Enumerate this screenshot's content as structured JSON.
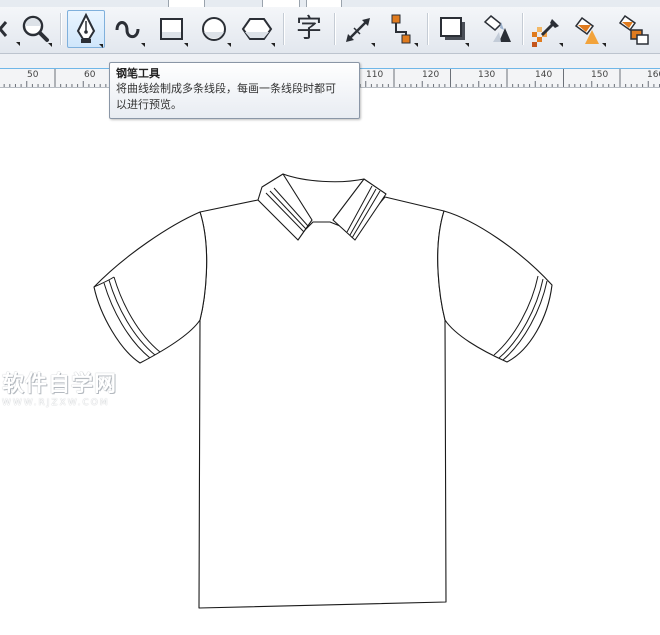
{
  "toolbar": {
    "tools": [
      {
        "id": "partial-left",
        "icon": "tool-icon"
      },
      {
        "id": "zoom",
        "icon": "magnifier-icon"
      },
      {
        "id": "pen",
        "icon": "pen-nib-icon",
        "active": true
      },
      {
        "id": "smart-drawing",
        "icon": "freehand-curve-icon"
      },
      {
        "id": "rectangle",
        "icon": "rectangle-icon"
      },
      {
        "id": "ellipse",
        "icon": "ellipse-icon"
      },
      {
        "id": "polygon",
        "icon": "polygon-icon"
      },
      {
        "id": "text",
        "icon": "text-icon",
        "glyph": "字"
      },
      {
        "id": "dimension",
        "icon": "dimension-arrow-icon"
      },
      {
        "id": "connector",
        "icon": "connector-icon"
      },
      {
        "id": "drop-shadow",
        "icon": "drop-shadow-icon"
      },
      {
        "id": "transparency",
        "icon": "transparency-icon"
      },
      {
        "id": "eyedropper",
        "icon": "eyedropper-icon"
      },
      {
        "id": "interactive-fill",
        "icon": "fill-bucket-icon"
      },
      {
        "id": "smart-fill",
        "icon": "smart-fill-icon"
      }
    ]
  },
  "ruler": {
    "labels": [
      "50",
      "60",
      "110",
      "120",
      "130",
      "140",
      "150",
      "160"
    ]
  },
  "tooltip": {
    "title": "钢笔工具",
    "body_line1": "将曲线绘制成多条线段，每画一条线段时都可",
    "body_line2": "以进行预览。"
  },
  "watermark": {
    "text": "软件自学网",
    "url": "WWW.RJZXW.COM"
  },
  "colors": {
    "accent": "#6fb7e8",
    "icon_orange": "#e07b1e",
    "icon_dark": "#2b2f36"
  }
}
